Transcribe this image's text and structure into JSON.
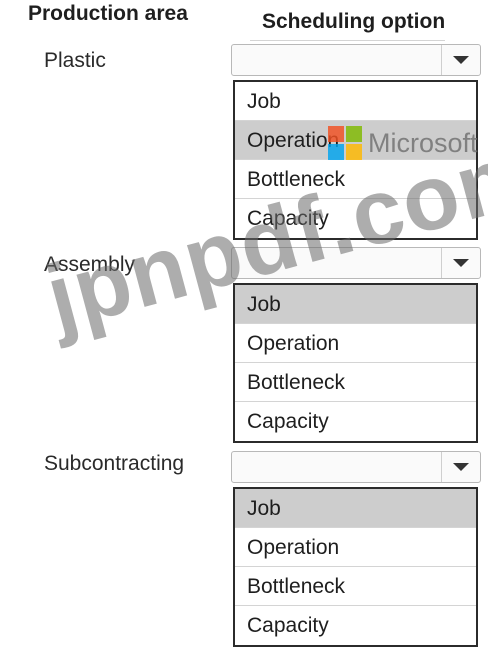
{
  "headers": {
    "production_area": "Production area",
    "scheduling_option": "Scheduling option"
  },
  "rows": [
    {
      "label": "Plastic",
      "selected_value": "",
      "options": [
        "Job",
        "Operation",
        "Bottleneck",
        "Capacity"
      ],
      "highlighted_option": "Operation"
    },
    {
      "label": "Assembly",
      "selected_value": "",
      "options": [
        "Job",
        "Operation",
        "Bottleneck",
        "Capacity"
      ],
      "highlighted_option": "Job"
    },
    {
      "label": "Subcontracting",
      "selected_value": "",
      "options": [
        "Job",
        "Operation",
        "Bottleneck",
        "Capacity"
      ],
      "highlighted_option": "Job"
    }
  ],
  "dropdown_icon": "chevron-down-icon",
  "watermarks": {
    "brand_text": "Microsoft",
    "brand_colors": [
      "#f25022",
      "#7fba00",
      "#00a4ef",
      "#ffb900"
    ],
    "site_text": "jpnpdf.com"
  }
}
